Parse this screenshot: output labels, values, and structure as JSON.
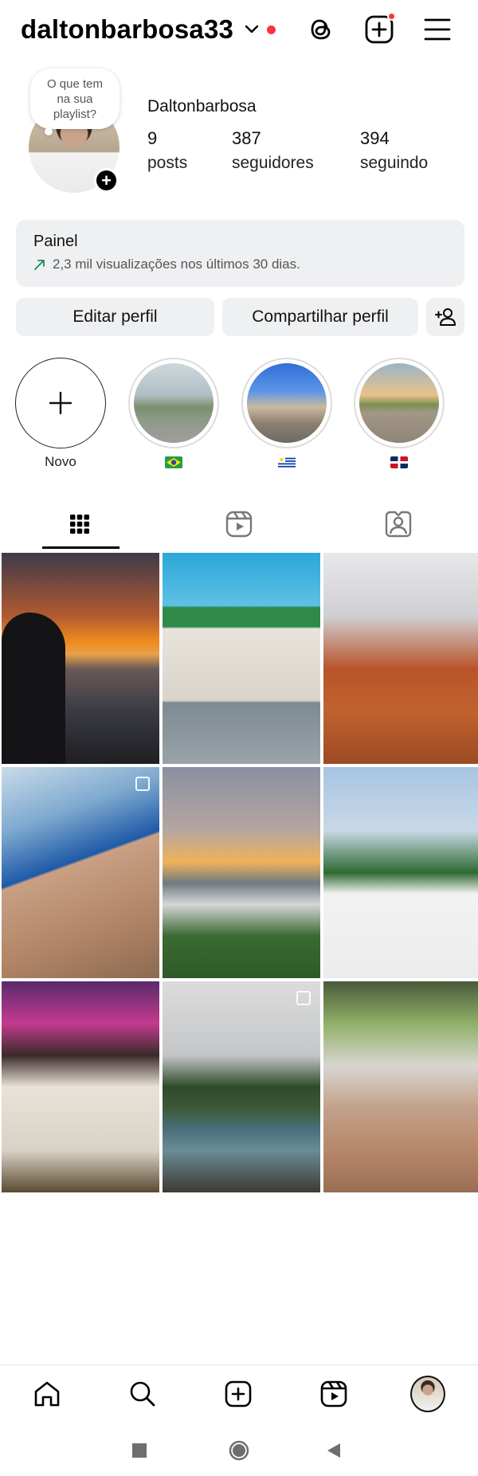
{
  "header": {
    "username": "daltonbarbosa33",
    "icons": [
      "chevron-down-icon",
      "threads-icon",
      "create-icon",
      "menu-icon"
    ],
    "colors": {
      "notification": "#ff3040"
    }
  },
  "profile": {
    "note": "O que tem na sua playlist?",
    "display_name": "Daltonbarbosa",
    "stats": [
      {
        "num": "9",
        "label": "posts"
      },
      {
        "num": "387",
        "label": "seguidores"
      },
      {
        "num": "394",
        "label": "seguindo"
      }
    ]
  },
  "painel": {
    "title": "Painel",
    "subtitle": "2,3 mil visualizações nos últimos 30 dias."
  },
  "buttons": {
    "edit": "Editar perfil",
    "share": "Compartilhar perfil",
    "add_person_icon": "add-person-icon"
  },
  "highlights": [
    {
      "label": "Novo"
    },
    {
      "flag": "brazil"
    },
    {
      "flag": "uruguay"
    },
    {
      "flag": "dominican-republic"
    }
  ],
  "tabs": [
    "grid-icon",
    "reels-icon",
    "tagged-icon"
  ],
  "bottom_nav": [
    "home-icon",
    "search-icon",
    "create-icon",
    "reels-icon",
    "profile-avatar"
  ],
  "system_nav": [
    "recents-button",
    "home-button",
    "back-button"
  ]
}
